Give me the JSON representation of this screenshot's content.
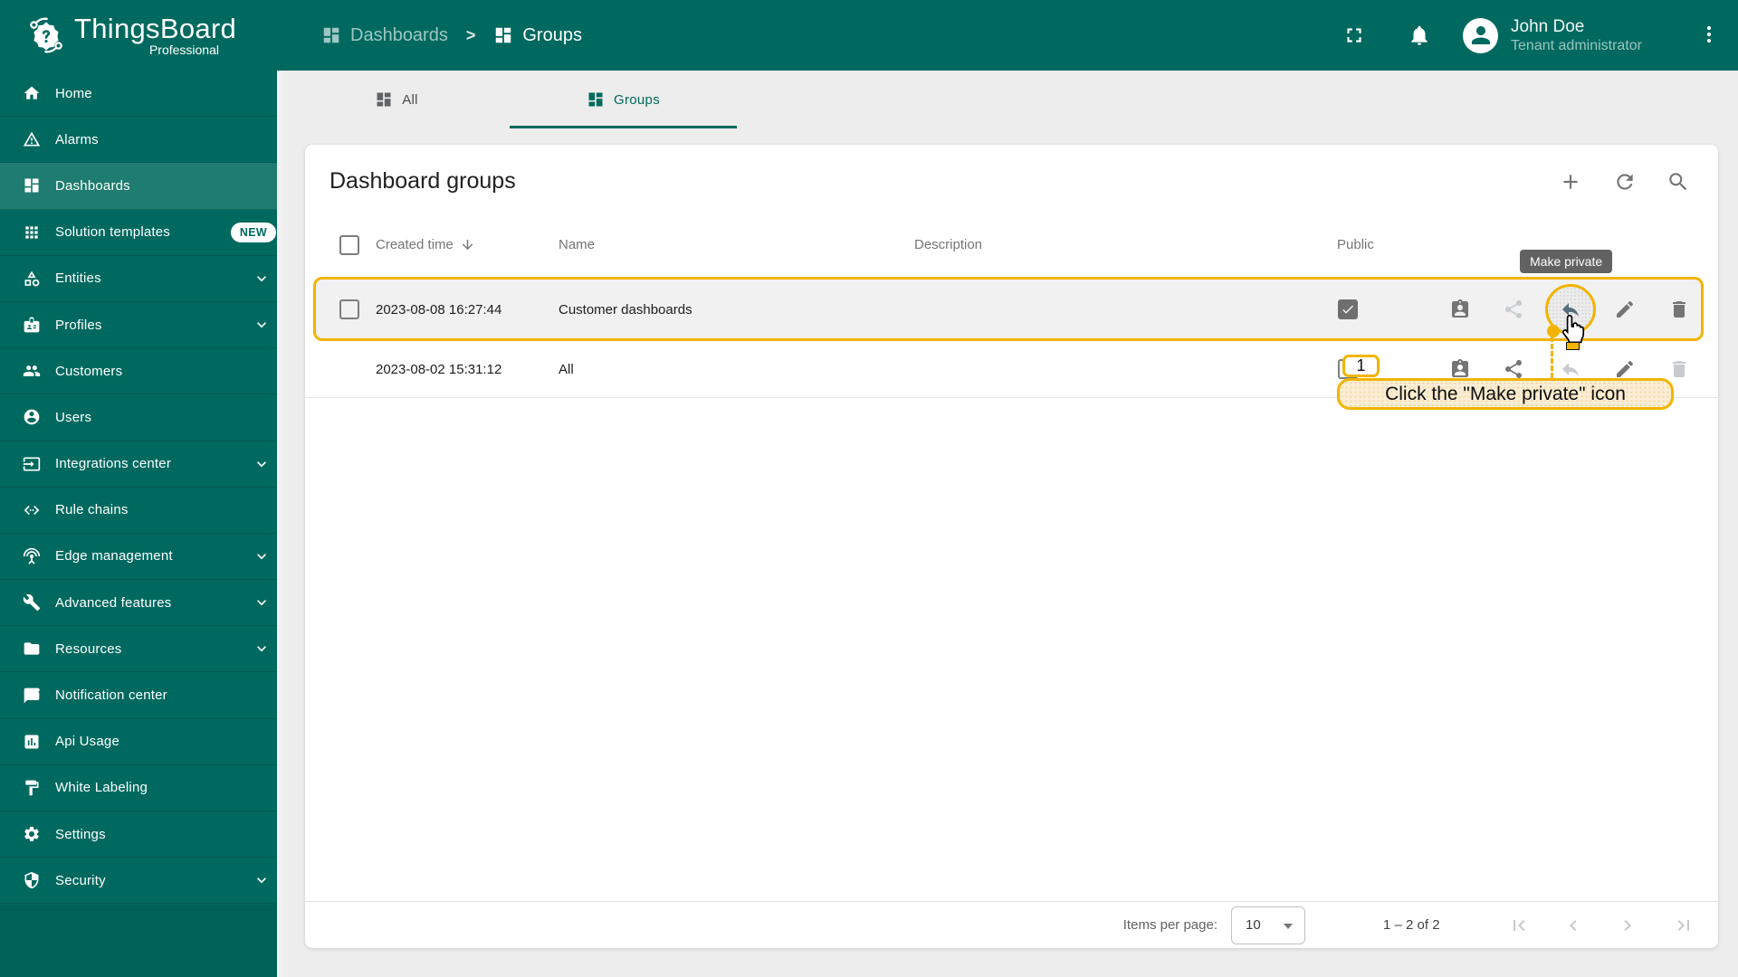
{
  "brand": {
    "name": "ThingsBoard",
    "edition": "Professional",
    "logo_icon": "thingsboard-gear-logo"
  },
  "topbar": {
    "breadcrumb": {
      "items": [
        "Dashboards",
        "Groups"
      ],
      "separator": ">",
      "icon": "dashboards-icon"
    },
    "icons": [
      "fullscreen-icon",
      "notifications-bell-icon",
      "avatar",
      "more-vert-icon"
    ],
    "user": {
      "name": "John Doe",
      "role": "Tenant administrator"
    }
  },
  "sidebar": {
    "items": [
      {
        "label": "Home",
        "icon": "home-icon"
      },
      {
        "label": "Alarms",
        "icon": "alarms-icon"
      },
      {
        "label": "Dashboards",
        "icon": "dashboards-icon",
        "selected": true
      },
      {
        "label": "Solution templates",
        "icon": "apps-grid-icon",
        "badge": "NEW"
      },
      {
        "label": "Entities",
        "icon": "category-icon",
        "expandable": true
      },
      {
        "label": "Profiles",
        "icon": "badge-icon",
        "expandable": true
      },
      {
        "label": "Customers",
        "icon": "people-icon"
      },
      {
        "label": "Users",
        "icon": "account-circle-icon"
      },
      {
        "label": "Integrations center",
        "icon": "integration-input-icon",
        "expandable": true
      },
      {
        "label": "Rule chains",
        "icon": "rule-chain-icon"
      },
      {
        "label": "Edge management",
        "icon": "antenna-icon",
        "expandable": true
      },
      {
        "label": "Advanced features",
        "icon": "tools-icon",
        "expandable": true
      },
      {
        "label": "Resources",
        "icon": "folder-icon",
        "expandable": true
      },
      {
        "label": "Notification center",
        "icon": "notification-chat-icon"
      },
      {
        "label": "Api Usage",
        "icon": "bar-chart-icon"
      },
      {
        "label": "White Labeling",
        "icon": "format-paint-icon"
      },
      {
        "label": "Settings",
        "icon": "gear-icon"
      },
      {
        "label": "Security",
        "icon": "shield-icon",
        "expandable": true
      }
    ]
  },
  "tabs": [
    {
      "label": "All",
      "icon": "dashboards-icon",
      "active": false
    },
    {
      "label": "Groups",
      "icon": "dashboards-icon",
      "active": true
    }
  ],
  "table": {
    "title": "Dashboard groups",
    "toolbar_icons": [
      "add-icon",
      "refresh-icon",
      "search-icon"
    ],
    "columns": {
      "created_time": "Created time",
      "name": "Name",
      "description": "Description",
      "public": "Public"
    },
    "sort": {
      "column": "Created time",
      "direction": "desc"
    },
    "row_action_icons": [
      "manage-owner-icon",
      "share-icon",
      "make-private-icon",
      "edit-icon",
      "delete-icon"
    ],
    "rows": [
      {
        "created_time": "2023-08-08 16:27:44",
        "name": "Customer dashboards",
        "description": "",
        "public": true,
        "selectable": true,
        "highlighted": true,
        "actions": {
          "manage_owner": true,
          "share": false,
          "make_private": true,
          "edit": true,
          "delete": true
        }
      },
      {
        "created_time": "2023-08-02 15:31:12",
        "name": "All",
        "description": "",
        "public": false,
        "selectable": false,
        "actions": {
          "manage_owner": true,
          "share": true,
          "make_private": false,
          "edit": true,
          "delete": false
        }
      }
    ]
  },
  "tooltip": {
    "text": "Make private"
  },
  "annotation": {
    "step": "1",
    "text": "Click the \"Make private\" icon"
  },
  "pagination": {
    "items_per_page_label": "Items per page:",
    "items_per_page_value": "10",
    "range_label": "1 – 2 of 2",
    "pager_icons": [
      "first-page-icon",
      "previous-page-icon",
      "next-page-icon",
      "last-page-icon"
    ]
  },
  "colors": {
    "primary_teal": "#00695F",
    "sidebar_selected": "#1E7C70",
    "highlight_amber": "#F2B400",
    "annotation_bg": "#FBEED6",
    "tooltip_bg": "#5C5C5C",
    "icon_gray": "#757575",
    "disabled_icon_gray": "#C6CBCE",
    "page_bg": "#EDEDED"
  }
}
